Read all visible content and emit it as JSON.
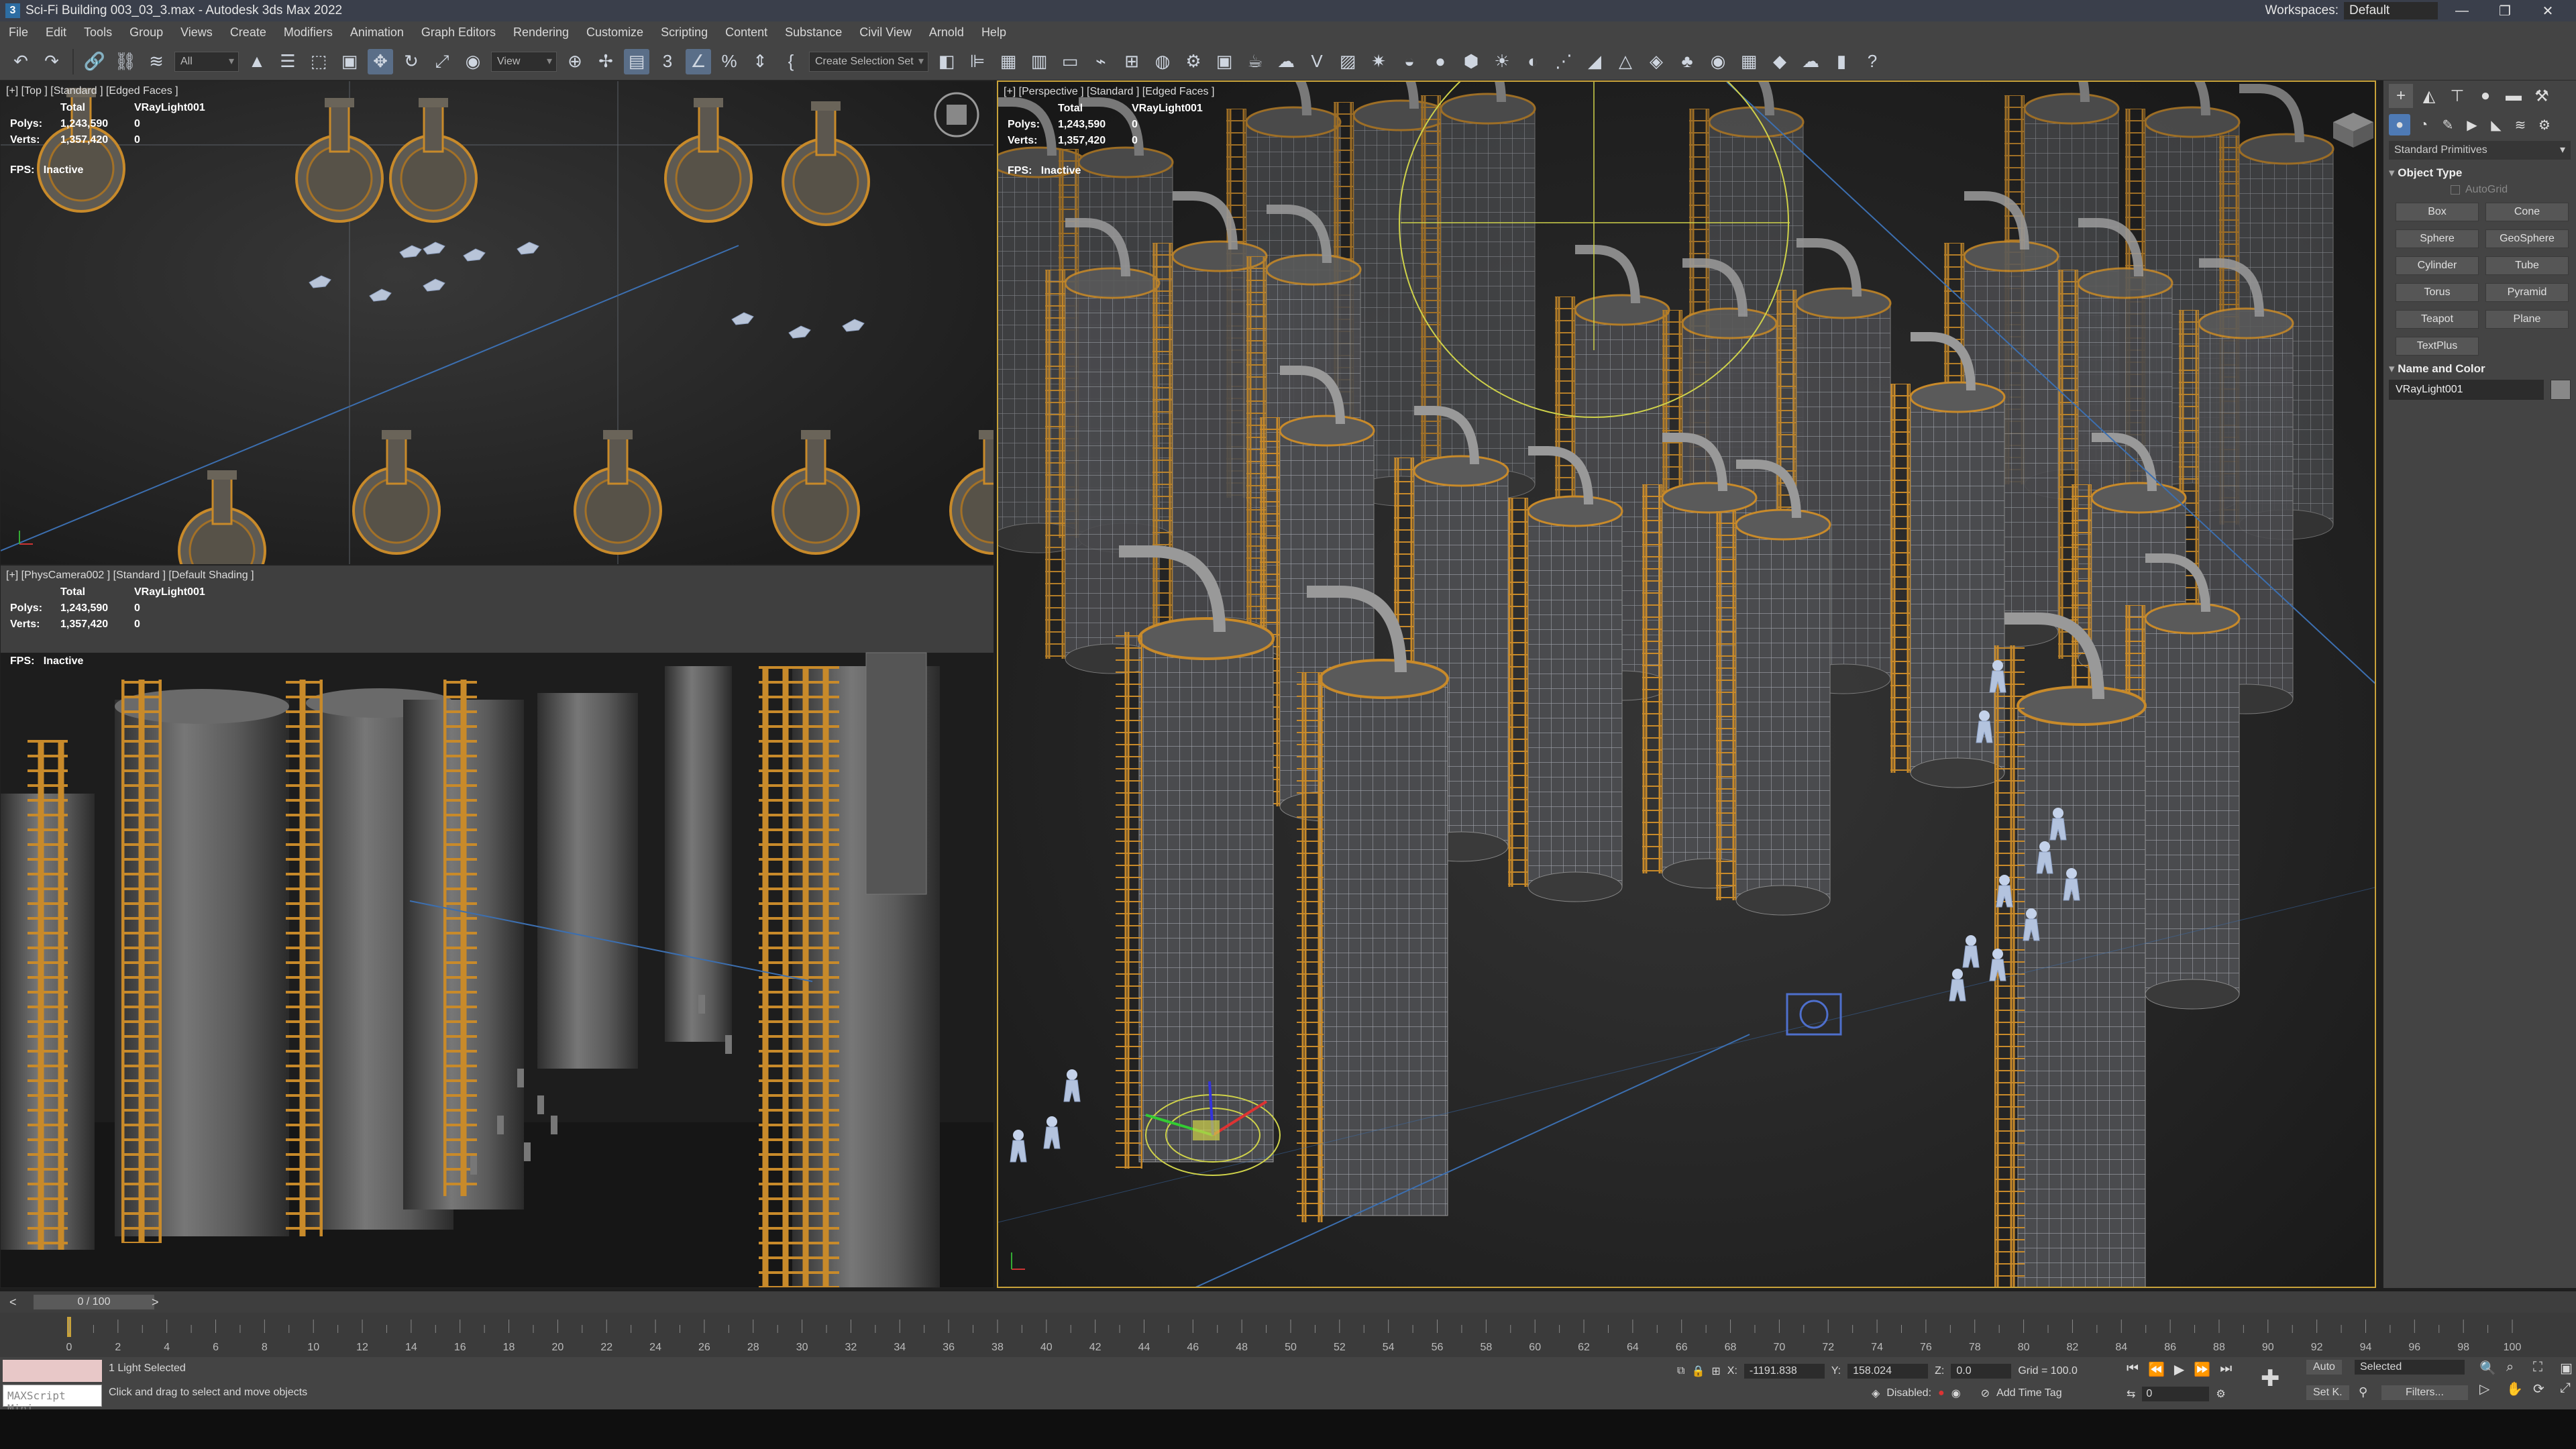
{
  "app": {
    "title": "Sci-Fi Building 003_03_3.max - Autodesk 3ds Max 2022",
    "workspace_label": "Workspaces:",
    "workspace_value": "Default"
  },
  "menu": [
    "File",
    "Edit",
    "Tools",
    "Group",
    "Views",
    "Create",
    "Modifiers",
    "Animation",
    "Graph Editors",
    "Rendering",
    "Customize",
    "Scripting",
    "Content",
    "Substance",
    "Civil View",
    "Arnold",
    "Help"
  ],
  "toolbar": {
    "filter": "All",
    "refcoord": "View",
    "selset": "Create Selection Set"
  },
  "viewports": {
    "top": {
      "label": "[+] [Top ] [Standard ] [Edged Faces ]",
      "total": "Total",
      "obj": "VRayLight001",
      "polys_label": "Polys:",
      "polys": "1,243,590",
      "polys_sel": "0",
      "verts_label": "Verts:",
      "verts": "1,357,420",
      "verts_sel": "0",
      "fps_label": "FPS:",
      "fps": "Inactive"
    },
    "camera": {
      "label": "[+] [PhysCamera002 ] [Standard ] [Default Shading ]",
      "total": "Total",
      "obj": "VRayLight001",
      "polys_label": "Polys:",
      "polys": "1,243,590",
      "polys_sel": "0",
      "verts_label": "Verts:",
      "verts": "1,357,420",
      "verts_sel": "0",
      "fps_label": "FPS:",
      "fps": "Inactive"
    },
    "persp": {
      "label": "[+] [Perspective ] [Standard ] [Edged Faces ]",
      "total": "Total",
      "obj": "VRayLight001",
      "polys_label": "Polys:",
      "polys": "1,243,590",
      "polys_sel": "0",
      "verts_label": "Verts:",
      "verts": "1,357,420",
      "verts_sel": "0",
      "fps_label": "FPS:",
      "fps": "Inactive"
    }
  },
  "command_panel": {
    "category": "Standard Primitives",
    "rollout_object": "Object Type",
    "autogrid": "AutoGrid",
    "buttons": [
      "Box",
      "Cone",
      "Sphere",
      "GeoSphere",
      "Cylinder",
      "Tube",
      "Torus",
      "Pyramid",
      "Teapot",
      "Plane",
      "TextPlus"
    ],
    "rollout_name": "Name and Color",
    "object_name": "VRayLight001"
  },
  "time": {
    "slider": "0 / 100",
    "ticks": [
      "0",
      "2",
      "4",
      "6",
      "8",
      "10",
      "12",
      "14",
      "16",
      "18",
      "20",
      "22",
      "24",
      "26",
      "28",
      "30",
      "32",
      "34",
      "36",
      "38",
      "40",
      "42",
      "44",
      "46",
      "48",
      "50",
      "52",
      "54",
      "56",
      "58",
      "60",
      "62",
      "64",
      "66",
      "68",
      "70",
      "72",
      "74",
      "76",
      "78",
      "80",
      "82",
      "84",
      "86",
      "88",
      "90",
      "92",
      "94",
      "96",
      "98",
      "100"
    ]
  },
  "status": {
    "selected": "1 Light Selected",
    "prompt": "Click and drag to select and move objects",
    "maxscript": "MAXScript Mini",
    "x_label": "X:",
    "x": "-1191.838",
    "y_label": "Y:",
    "y": "158.024",
    "z_label": "Z:",
    "z": "0.0",
    "grid": "Grid = 100.0",
    "disabled": "Disabled:",
    "add_time_tag": "Add Time Tag",
    "auto": "Auto",
    "selected_dd": "Selected",
    "setk": "Set K.",
    "filters": "Filters...",
    "frame": "0"
  },
  "colors": {
    "accent": "#4e7ab5",
    "ladder": "#c88a2a",
    "wire": "#a0a4ab",
    "light": "#cfd24a"
  }
}
